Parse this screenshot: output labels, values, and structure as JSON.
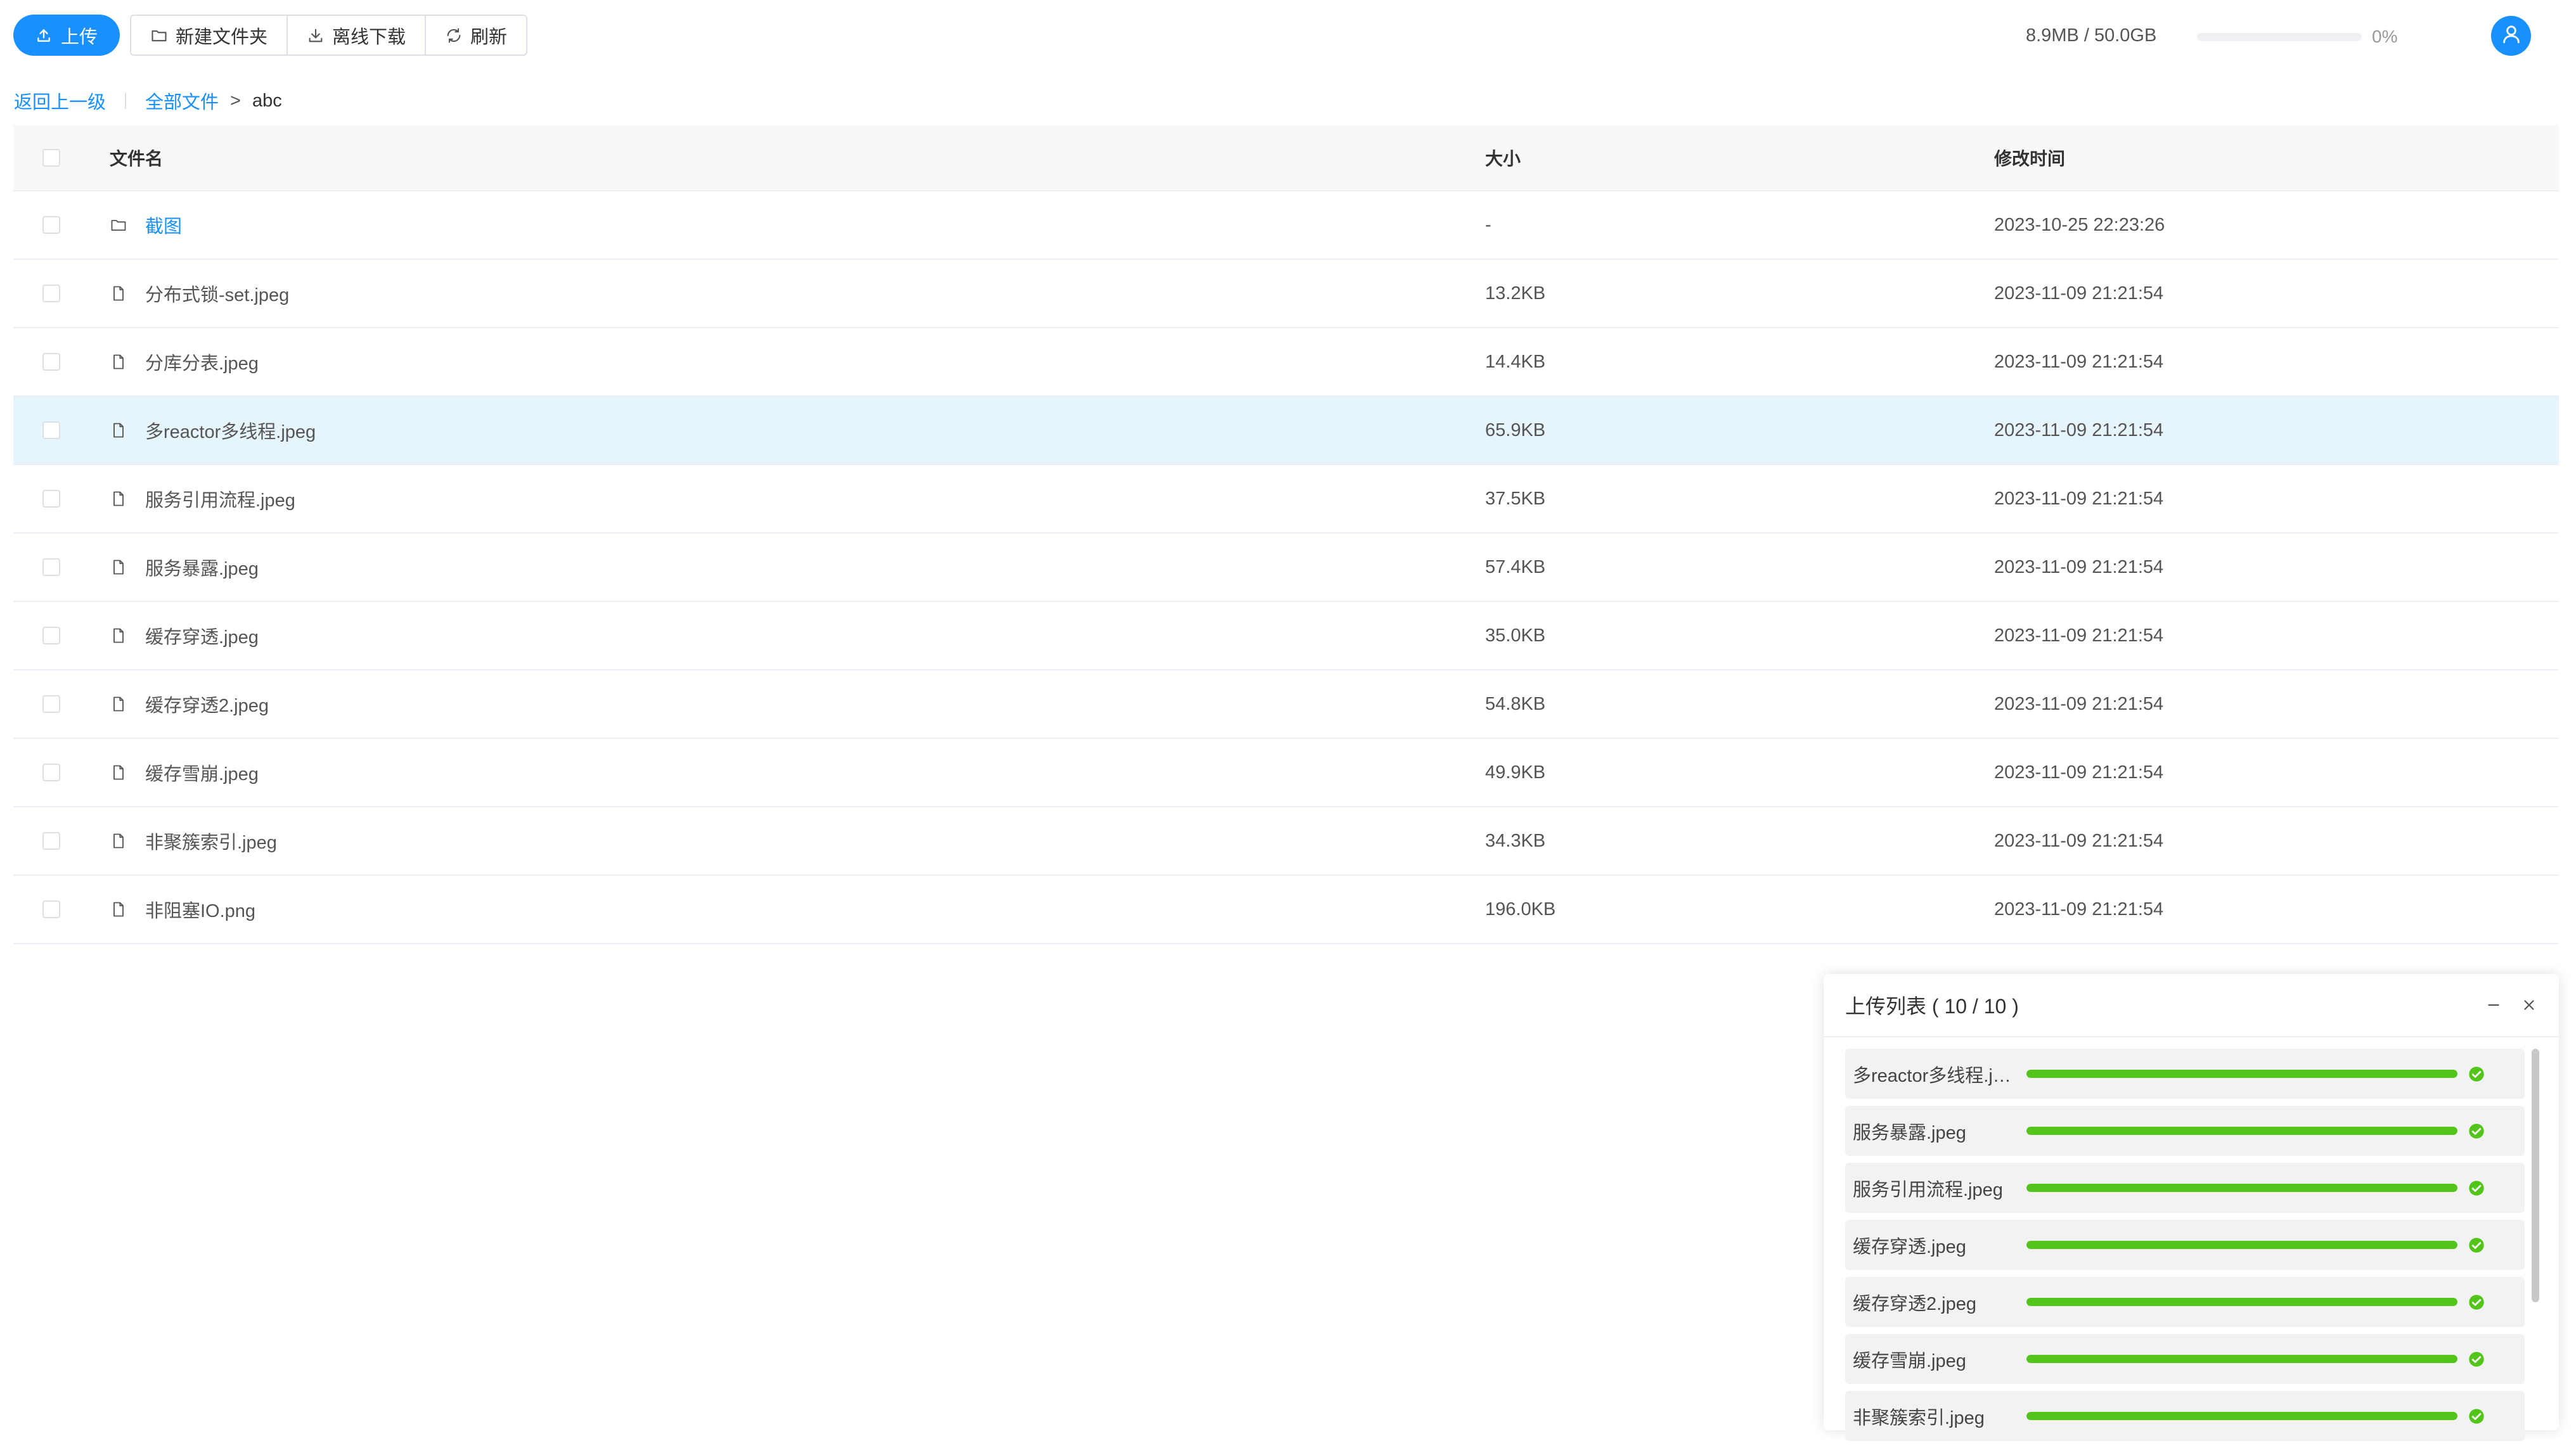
{
  "toolbar": {
    "upload_label": "上传",
    "new_folder_label": "新建文件夹",
    "offline_download_label": "离线下载",
    "refresh_label": "刷新"
  },
  "storage": {
    "usage_text": "8.9MB / 50.0GB",
    "percent_text": "0%",
    "percent_value": 0
  },
  "breadcrumb": {
    "back_label": "返回上一级",
    "all_files_label": "全部文件",
    "separator": ">",
    "current": "abc"
  },
  "table": {
    "headers": {
      "name": "文件名",
      "size": "大小",
      "modified": "修改时间"
    },
    "rows": [
      {
        "name": "截图",
        "type": "folder",
        "size": "-",
        "modified": "2023-10-25 22:23:26"
      },
      {
        "name": "分布式锁-set.jpeg",
        "type": "file",
        "size": "13.2KB",
        "modified": "2023-11-09 21:21:54"
      },
      {
        "name": "分库分表.jpeg",
        "type": "file",
        "size": "14.4KB",
        "modified": "2023-11-09 21:21:54"
      },
      {
        "name": "多reactor多线程.jpeg",
        "type": "file",
        "size": "65.9KB",
        "modified": "2023-11-09 21:21:54"
      },
      {
        "name": "服务引用流程.jpeg",
        "type": "file",
        "size": "37.5KB",
        "modified": "2023-11-09 21:21:54"
      },
      {
        "name": "服务暴露.jpeg",
        "type": "file",
        "size": "57.4KB",
        "modified": "2023-11-09 21:21:54"
      },
      {
        "name": "缓存穿透.jpeg",
        "type": "file",
        "size": "35.0KB",
        "modified": "2023-11-09 21:21:54"
      },
      {
        "name": "缓存穿透2.jpeg",
        "type": "file",
        "size": "54.8KB",
        "modified": "2023-11-09 21:21:54"
      },
      {
        "name": "缓存雪崩.jpeg",
        "type": "file",
        "size": "49.9KB",
        "modified": "2023-11-09 21:21:54"
      },
      {
        "name": "非聚簇索引.jpeg",
        "type": "file",
        "size": "34.3KB",
        "modified": "2023-11-09 21:21:54"
      },
      {
        "name": "非阻塞IO.png",
        "type": "file",
        "size": "196.0KB",
        "modified": "2023-11-09 21:21:54"
      }
    ]
  },
  "upload_panel": {
    "title": "上传列表 ( 10 / 10 )",
    "items": [
      {
        "name": "多reactor多线程.jpeg",
        "progress": 1.0,
        "status": "success-icon"
      },
      {
        "name": "服务暴露.jpeg",
        "progress": 1.0,
        "status": "success-icon"
      },
      {
        "name": "服务引用流程.jpeg",
        "progress": 1.0,
        "status": "success-icon"
      },
      {
        "name": "缓存穿透.jpeg",
        "progress": 1.0,
        "status": "success-icon"
      },
      {
        "name": "缓存穿透2.jpeg",
        "progress": 1.0,
        "status": "success-icon"
      },
      {
        "name": "缓存雪崩.jpeg",
        "progress": 1.0,
        "status": "success-icon"
      },
      {
        "name": "非聚簇索引.jpeg",
        "progress": 1.0,
        "status": "success-icon"
      }
    ]
  },
  "colors": {
    "primary": "#1890ff",
    "success": "#52c41a",
    "row_highlight": "#e6f4fc"
  }
}
